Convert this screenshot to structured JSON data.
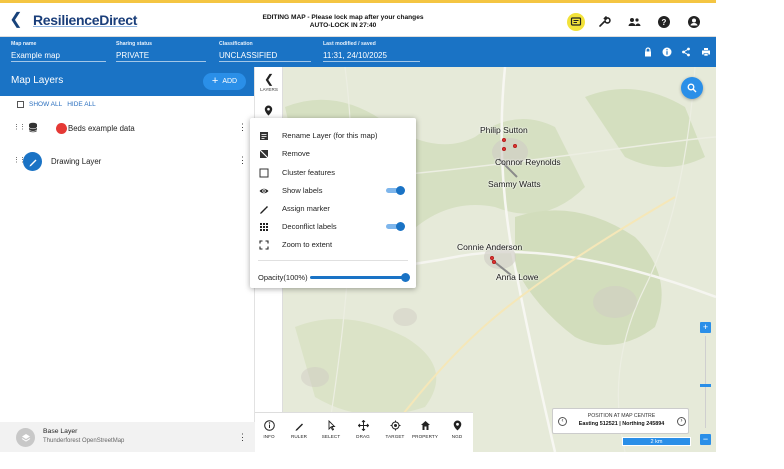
{
  "topbar": {
    "back_icon": "back-arrow-icon",
    "logo": "ResilienceDirect",
    "banner_line1": "EDITING MAP - Please lock map after your changes",
    "banner_line2": "AUTO-LOCK IN 27:40",
    "icons": [
      "chat-icon",
      "wrench-icon",
      "people-icon",
      "help-icon",
      "account-icon"
    ]
  },
  "infobar": {
    "map_name_label": "Map name",
    "map_name": "Example map",
    "sharing_label": "Sharing status",
    "sharing": "PRIVATE",
    "classification_label": "Classification",
    "classification": "UNCLASSIFIED",
    "modified_label": "Last modified / saved",
    "modified": "11:31, 24/10/2025",
    "icons": [
      "lock-icon",
      "info-icon",
      "share-icon",
      "print-icon"
    ]
  },
  "sidebar": {
    "title": "Map Layers",
    "add_label": "ADD",
    "show_all": "SHOW ALL",
    "hide_all": "HIDE ALL",
    "layers": [
      {
        "name": "Beds example data",
        "color": "#e53935"
      },
      {
        "name": "Drawing Layer",
        "color": "#1a73c5"
      }
    ],
    "base_layer": {
      "title": "Base Layer",
      "subtitle": "Thunderforest OpenStreetMap"
    }
  },
  "layers_strip": {
    "label": "LAYERS"
  },
  "context_menu": {
    "items": [
      {
        "label": "Rename Layer (for this map)",
        "icon": "rename-icon"
      },
      {
        "label": "Remove",
        "icon": "remove-icon"
      },
      {
        "label": "Cluster features",
        "icon": "checkbox-icon"
      },
      {
        "label": "Show labels",
        "icon": "eye-icon",
        "toggle": true
      },
      {
        "label": "Assign marker",
        "icon": "marker-pen-icon"
      },
      {
        "label": "Deconflict labels",
        "icon": "grid-dots-icon",
        "toggle": true
      },
      {
        "label": "Zoom to extent",
        "icon": "zoom-extent-icon"
      }
    ],
    "opacity_label": "Opacity(100%)",
    "opacity_value": 1.0
  },
  "toolbar": {
    "tools": [
      "INFO",
      "RULER",
      "SELECT",
      "DRAG",
      "TARGET",
      "PROPERTY",
      "NGD"
    ]
  },
  "map": {
    "labels": [
      "Philip Sutton",
      "Connor Reynolds",
      "Sammy Watts",
      "Connie Anderson",
      "Anna Lowe"
    ]
  },
  "position": {
    "title": "POSITION AT MAP CENTRE",
    "value": "Easting 512521 | Northing 245894",
    "scale": "2 km"
  },
  "colors": {
    "primary": "#1a73c5",
    "accent": "#2a8fe8",
    "banner": "#f4c542"
  }
}
